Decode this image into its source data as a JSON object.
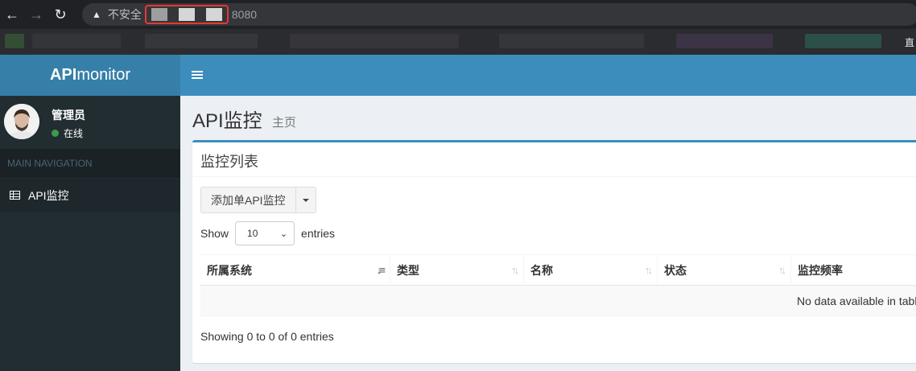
{
  "browser": {
    "address_prefix": "不安全",
    "port_text": "8080",
    "bookmark_right": "直"
  },
  "header": {
    "logo_bold": "API",
    "logo_light": "monitor"
  },
  "sidebar": {
    "user_name": "管理员",
    "user_status": "在线",
    "nav_header": "MAIN NAVIGATION",
    "items": [
      {
        "label": "API监控",
        "icon": "table-icon"
      }
    ]
  },
  "content": {
    "page_title": "API监控",
    "page_subtitle": "主页",
    "box_title": "监控列表",
    "add_button": "添加单API监控",
    "show_label": "Show",
    "entries_value": "10",
    "entries_label": "entries",
    "columns": [
      "所属系统",
      "类型",
      "名称",
      "状态",
      "监控频率"
    ],
    "empty_text": "No data available in table",
    "info_text": "Showing 0 to 0 of 0 entries"
  },
  "colors": {
    "header": "#3c8dbc",
    "logo_bg": "#367fa9",
    "sidebar": "#222d32",
    "online": "#3c9a4a"
  }
}
